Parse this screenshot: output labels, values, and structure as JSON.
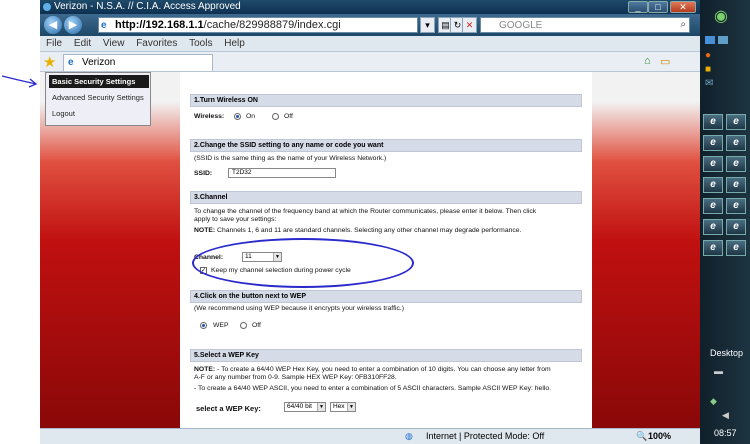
{
  "window": {
    "title": "Verizon - N.S.A. // C.I.A. Access Approved",
    "url_host": "http://192.168.1.1",
    "url_path": "/cache/829988879/index.cgi",
    "search_placeholder": "GOOGLE"
  },
  "menu": [
    "File",
    "Edit",
    "View",
    "Favorites",
    "Tools",
    "Help"
  ],
  "tab": {
    "label": "Verizon"
  },
  "sidebar": {
    "items": [
      {
        "label": "Basic Security Settings",
        "active": true
      },
      {
        "label": "Advanced Security Settings",
        "active": false
      },
      {
        "label": "Logout",
        "active": false
      }
    ]
  },
  "sections": {
    "s1": {
      "title": "1.Turn Wireless ON",
      "label": "Wireless:",
      "on": "On",
      "off": "Off",
      "selected": "On"
    },
    "s2": {
      "title": "2.Change the SSID setting to any name or code you want",
      "note": "(SSID is the same thing as the name of your Wireless Network.)",
      "label": "SSID:",
      "value": "T2D32"
    },
    "s3": {
      "title": "3.Channel",
      "desc1": "To change the channel of the frequency band at which the Router communicates, please enter it below. Then click",
      "desc2": "apply to save your settings:",
      "note_label": "NOTE:",
      "note": "Channels 1, 6 and 11 are standard channels. Selecting any other channel may degrade performance.",
      "channel_label": "Channel:",
      "channel_value": "11",
      "keep_label": "Keep my channel selection during power cycle",
      "keep_checked": true
    },
    "s4": {
      "title": "4.Click on the button next to WEP",
      "note": "(We recommend using WEP because it encrypts your wireless traffic.)",
      "wep": "WEP",
      "off": "Off",
      "selected": "WEP"
    },
    "s5": {
      "title": "5.Select a WEP Key",
      "note_label": "NOTE:",
      "line1": "- To create a 64/40 WEP Hex Key, you need to enter a combination of 10 digits. You can choose any letter from",
      "line2": "A-F or any number from 0-9. Sample HEX WEP Key: 0FB310FF28.",
      "line3": "- To create a 64/40 WEP ASCII, you need to enter a combination of 5 ASCII characters. Sample ASCII WEP Key: hello.",
      "key_label": "select a WEP Key:",
      "key_bits": "64/40 bit",
      "key_type": "Hex"
    }
  },
  "status": {
    "zone": "Internet | Protected Mode: Off",
    "zoom": "100%"
  },
  "taskbar": {
    "desktop_label": "Desktop",
    "clock": "08:57"
  },
  "colors": {
    "titlebar": "#1f4b6b",
    "accent_red": "#c01010",
    "annotation": "#2a2acc"
  }
}
